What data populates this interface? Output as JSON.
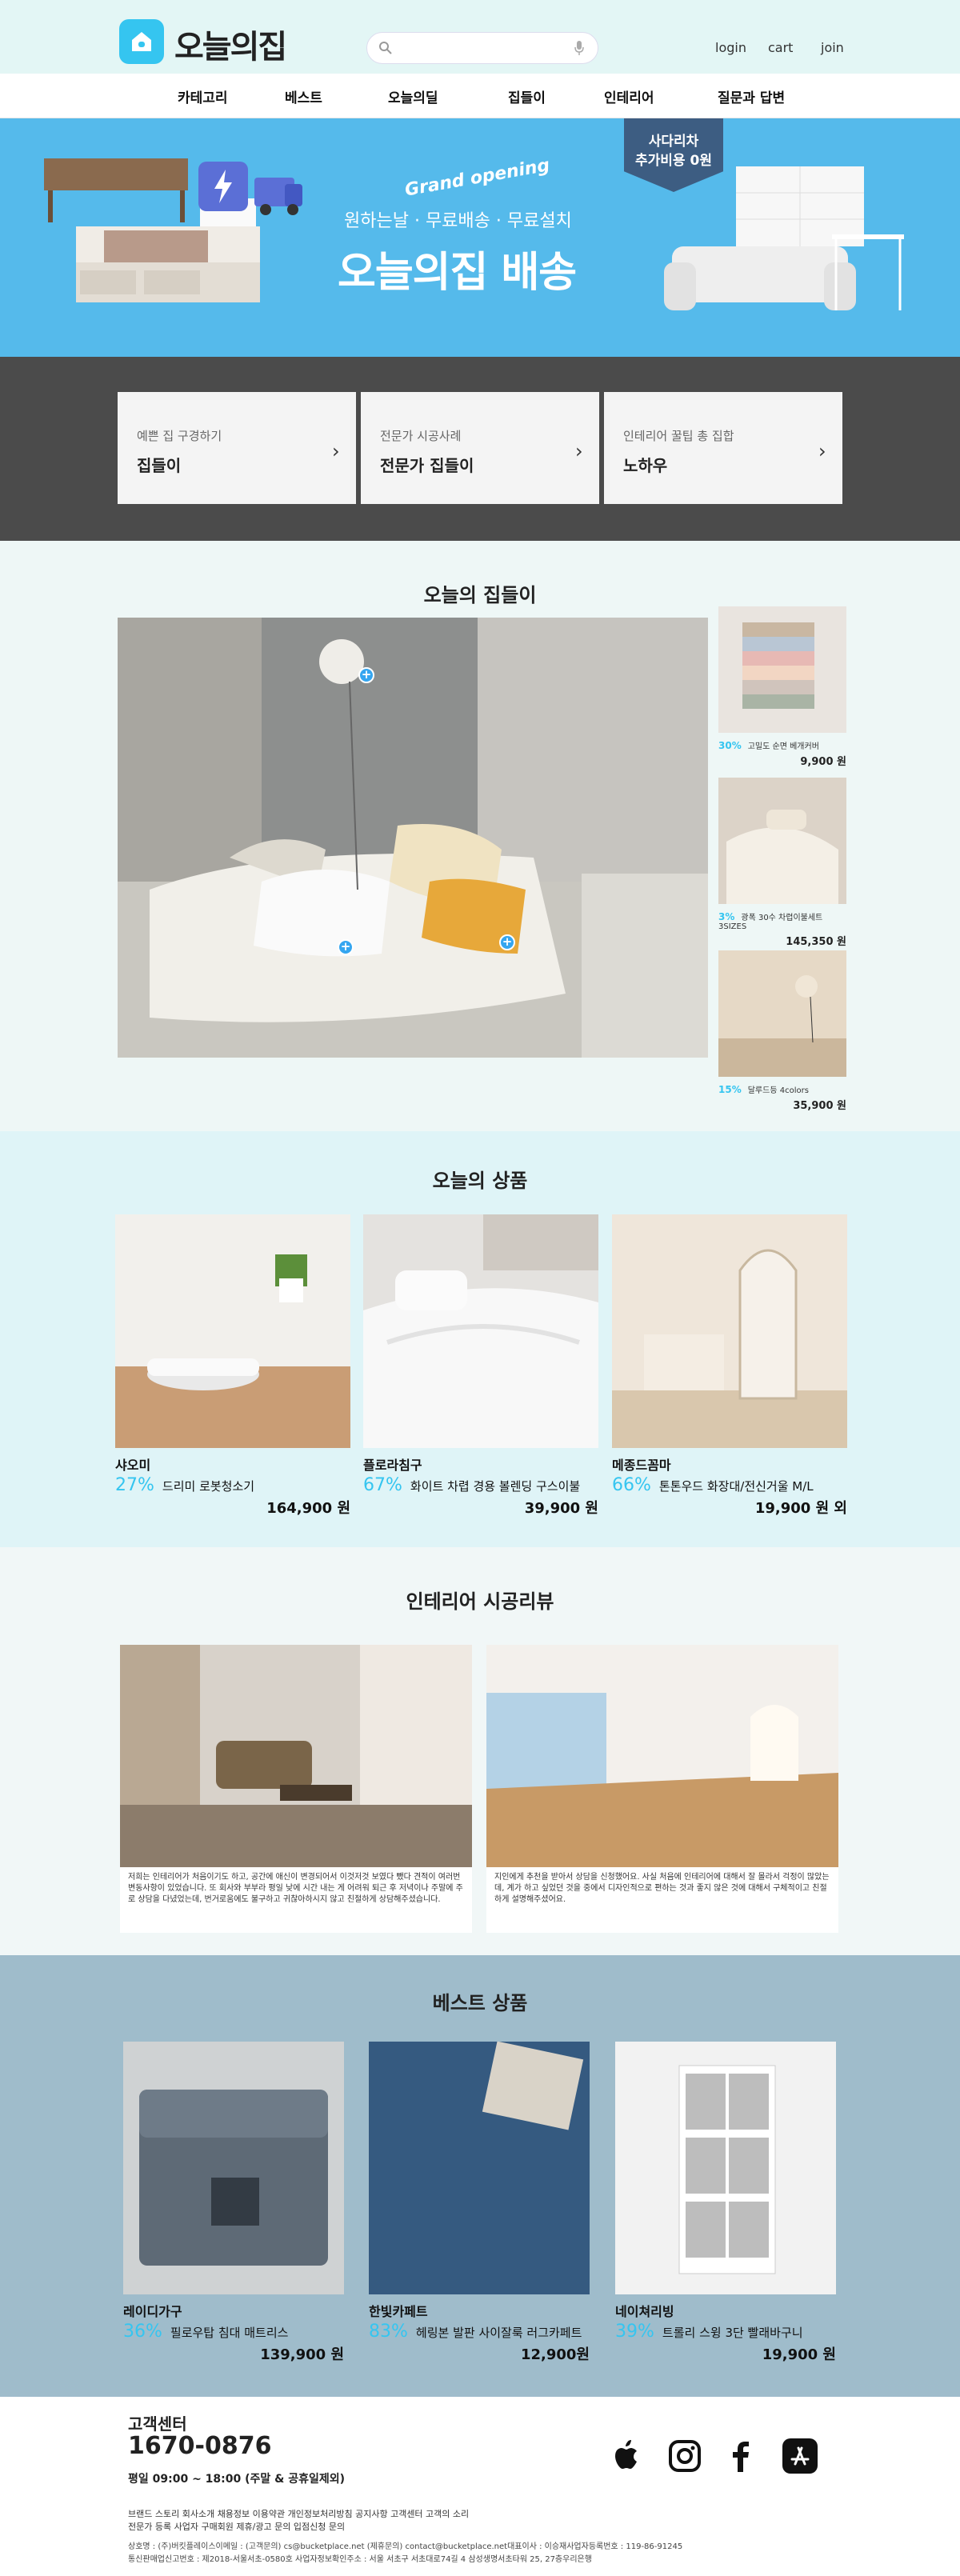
{
  "header": {
    "logo_text": "오늘의집",
    "search_placeholder": "",
    "links": [
      "login",
      "cart",
      "join"
    ]
  },
  "nav": {
    "items": [
      "카테고리",
      "베스트",
      "오늘의딜",
      "집들이",
      "인테리어",
      "질문과 답변"
    ]
  },
  "banner": {
    "grand": "Grand opening",
    "subtitle": "원하는날 · 무료배송 · 무료설치",
    "title": "오늘의집 배송",
    "badge_line1": "사다리차",
    "badge_line2": "추가비용 0원"
  },
  "quick_links": [
    {
      "small": "예쁜 집 구경하기",
      "big": "집들이"
    },
    {
      "small": "전문가 시공사례",
      "big": "전문가 집들이"
    },
    {
      "small": "인테리어 꿀팁 총 집합",
      "big": "노하우"
    }
  ],
  "today_house": {
    "title": "오늘의 집들이",
    "items": [
      {
        "pct": "30%",
        "name": "고밀도 순면 베개커버",
        "price": "9,900 원"
      },
      {
        "pct": "3%",
        "name": "광폭 30수 차렵이불세트 3SIZES",
        "price": "145,350 원"
      },
      {
        "pct": "15%",
        "name": "달루드등 4colors",
        "price": "35,900 원"
      }
    ]
  },
  "today_products": {
    "title": "오늘의 상품",
    "items": [
      {
        "brand": "샤오미",
        "pct": "27%",
        "name": "드리미 로봇청소기",
        "price": "164,900 원"
      },
      {
        "brand": "플로라침구",
        "pct": "67%",
        "name": "화이트 차렵 경용 볼렌딩 구스이불",
        "price": "39,900 원"
      },
      {
        "brand": "메종드꼼마",
        "pct": "66%",
        "name": "톤톤우드 화장대/전신거울 M/L",
        "price": "19,900 원 외"
      }
    ]
  },
  "review": {
    "title": "인테리어 시공리뷰",
    "items": [
      {
        "text": "저희는 인테리어가 처음이기도 하고, 공간에 애신이 변경되어서 이것저것 보였다 뺐다 견적이 여러번 변동사항이 있었습니다. 또 회사와 부부라 평일 낮에 시간 내는 게 어려워 퇴근 후 저녁이나 주말에 주로 상담을 다녔었는데, 번거로움에도 불구하고 귀찮아하시지 않고 친절하게 상담해주셨습니다."
      },
      {
        "text": "지인에게 추천을 받아서 상담을 신청했어요. 사실 처음에 인테리어에 대해서 잘 몰라서 걱정이 많았는데, 계가 하고 싶었던 것을 중에서 디자인적으로 편하는 것과 좋지 않은 것에 대해서 구체적이고 친절하게 설명해주셨어요."
      }
    ]
  },
  "best": {
    "title": "베스트 상품",
    "items": [
      {
        "brand": "레이디가구",
        "pct": "36%",
        "name": "필로우탑 침대 매트리스",
        "price": "139,900 원"
      },
      {
        "brand": "한빛카페트",
        "pct": "83%",
        "name": "헤링본 발판 사이잘룩 러그카페트",
        "price": "12,900원"
      },
      {
        "brand": "네이쳐리빙",
        "pct": "39%",
        "name": "트롤리 스윙 3단 빨래바구니",
        "price": "19,900 원"
      }
    ]
  },
  "footer": {
    "cs_label": "고객센터",
    "phone": "1670-0876",
    "hours": "평일 09:00 ~ 18:00 (주말 & 공휴일제외)",
    "links": "브랜드 스토리  회사소개  채용정보  이용약관  개인정보처리방침  공지사항  고객센터  고객의 소리",
    "links2": "전문가 등록  사업자 구매회원  제휴/광고 문의  입점신청 문의",
    "company": "상호명 : (주)버킷플레이스이메일 : (고객문의) cs@bucketplace.net (제휴문의) contact@bucketplace.net대표이사 : 이승재사업자등록번호 : 119-86-91245",
    "company2": "통신판매업신고번호 : 제2018-서울서초-0580호 사업자정보확인주소 : 서울 서초구 서초대로74길 4 삼성생명서초타워 25, 27층우리은행"
  },
  "colors": {
    "accent": "#35c5f0",
    "topbar": "#e3f6f5",
    "banner": "#55baeb",
    "dark": "#4b4b4b",
    "best_bg": "#9fbccb"
  }
}
